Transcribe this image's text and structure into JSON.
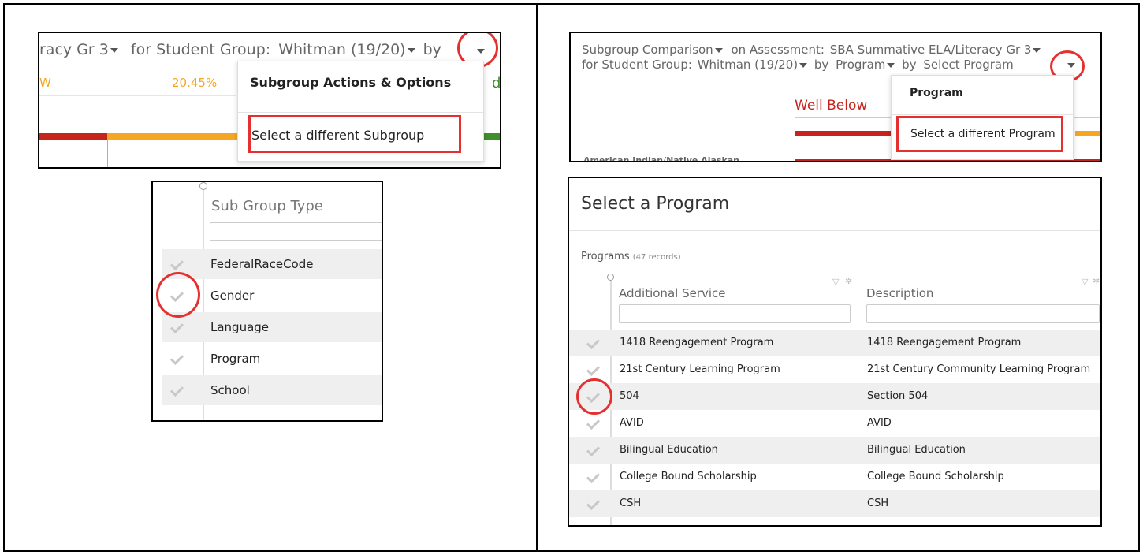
{
  "panel_a": {
    "header": {
      "part1": "racy Gr 3",
      "part2": "for Student Group:",
      "part3": "Whitman (19/20)",
      "part4": "by"
    },
    "bar_left_label": "W",
    "bar_percent": "20.45%",
    "partial_right": "d",
    "menu": {
      "title": "Subgroup Actions & Options",
      "item": "Select a different Subgroup"
    },
    "colors": {
      "red": "#c9231d",
      "orange": "#f5a623",
      "green": "#3f8f2a"
    }
  },
  "panel_b": {
    "column": "Sub Group Type",
    "rows": [
      "FederalRaceCode",
      "Gender",
      "Language",
      "Program",
      "School"
    ]
  },
  "panel_c": {
    "line1": {
      "a": "Subgroup Comparison",
      "b": "on Assessment:",
      "c": "SBA Summative ELA/Literacy Gr 3"
    },
    "line2": {
      "a": "for Student Group:",
      "b": "Whitman (19/20)",
      "c": "by",
      "d": "Program",
      "e": "by",
      "f": "Select Program"
    },
    "well_below": "Well Below",
    "row_label_partial": "American Indian/Native Alaskan",
    "menu": {
      "title": "Program",
      "item": "Select a different Program"
    }
  },
  "panel_d": {
    "title": "Select a Program",
    "subtitle": "Programs",
    "records": "(47 records)",
    "columns": [
      "Additional Service",
      "Description"
    ],
    "rows": [
      [
        "1418 Reengagement Program",
        "1418 Reengagement Program"
      ],
      [
        "21st Century Learning Program",
        "21st Century Community Learning Program"
      ],
      [
        "504",
        "Section 504"
      ],
      [
        "AVID",
        "AVID"
      ],
      [
        "Bilingual Education",
        "Bilingual Education"
      ],
      [
        "College Bound Scholarship",
        "College Bound Scholarship"
      ],
      [
        "CSH",
        "CSH"
      ]
    ]
  }
}
